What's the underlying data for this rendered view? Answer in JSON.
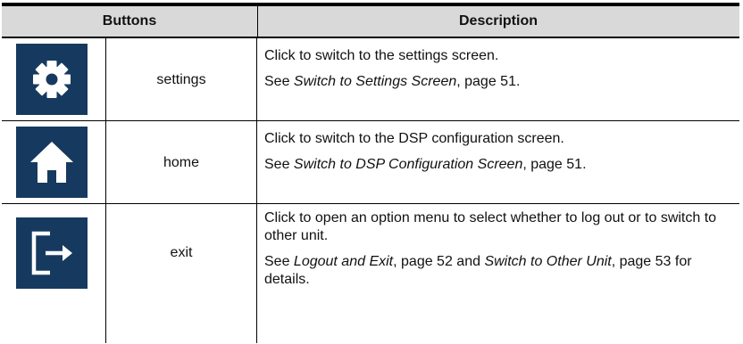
{
  "header": {
    "buttons": "Buttons",
    "description": "Description"
  },
  "rows": [
    {
      "icon": "gear-icon",
      "name": "settings",
      "line1": "Click to switch to the settings screen.",
      "see_prefix": "See ",
      "see_link": "Switch to Settings Screen",
      "see_suffix": ", page 51."
    },
    {
      "icon": "home-icon",
      "name": "home",
      "line1": "Click to switch to the DSP configuration screen.",
      "see_prefix": "See ",
      "see_link": "Switch to DSP Configuration Screen",
      "see_suffix": ", page 51."
    },
    {
      "icon": "exit-icon",
      "name": "exit",
      "line1": "Click to open an option menu to select whether to log out or to switch to other unit.",
      "see_prefix": "See ",
      "see_link": "Logout and Exit",
      "see_mid": ", page 52 and ",
      "see_link2": "Switch to Other Unit",
      "see_suffix": ", page 53 for details."
    }
  ],
  "colors": {
    "icon_bg": "#163a5f",
    "icon_fg": "#ffffff",
    "header_bg": "#d9d9d9"
  }
}
